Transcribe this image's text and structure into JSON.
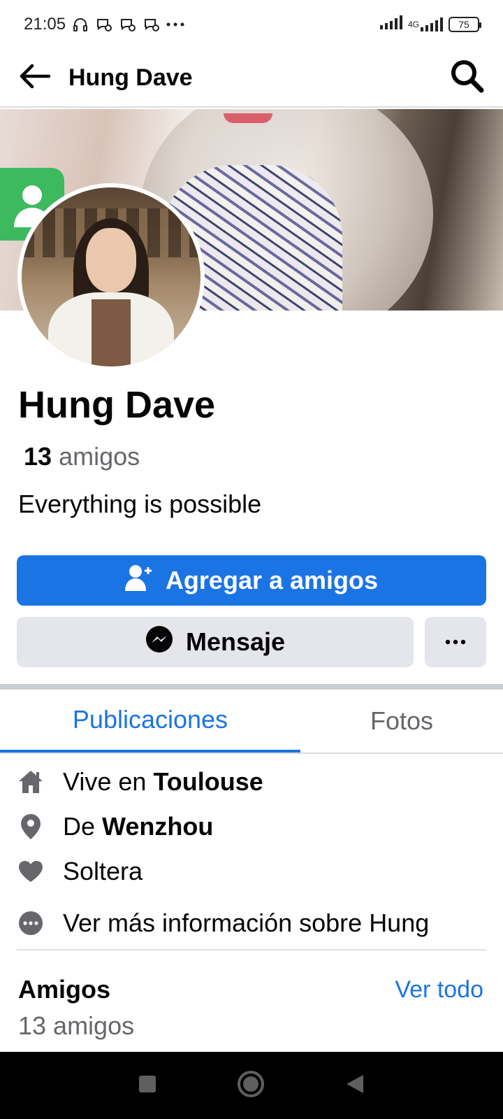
{
  "status_bar": {
    "time": "21:05",
    "network_label": "4G",
    "battery": "75"
  },
  "header": {
    "title": "Hung Dave"
  },
  "profile": {
    "name": "Hung Dave",
    "friends_number": "13",
    "friends_word": "amigos",
    "bio": "Everything is possible"
  },
  "actions": {
    "add_friend": "Agregar a amigos",
    "message": "Mensaje"
  },
  "tabs": {
    "posts": "Publicaciones",
    "photos": "Fotos"
  },
  "details": {
    "lives_prefix": "Vive en",
    "lives_city": "Toulouse",
    "from_prefix": "De",
    "from_city": "Wenzhou",
    "relationship": "Soltera",
    "more_info": "Ver más información sobre Hung"
  },
  "friends_section": {
    "title": "Amigos",
    "see_all": "Ver todo",
    "count_label": "13 amigos"
  },
  "colors": {
    "accent": "#1b74e4",
    "secondary_button": "#e4e6eb",
    "muted_text": "#65676b"
  },
  "icons": [
    "back-arrow-icon",
    "search-icon",
    "add-friend-icon",
    "messenger-icon",
    "more-dots-icon",
    "home-icon",
    "location-pin-icon",
    "heart-icon",
    "more-circle-icon"
  ]
}
